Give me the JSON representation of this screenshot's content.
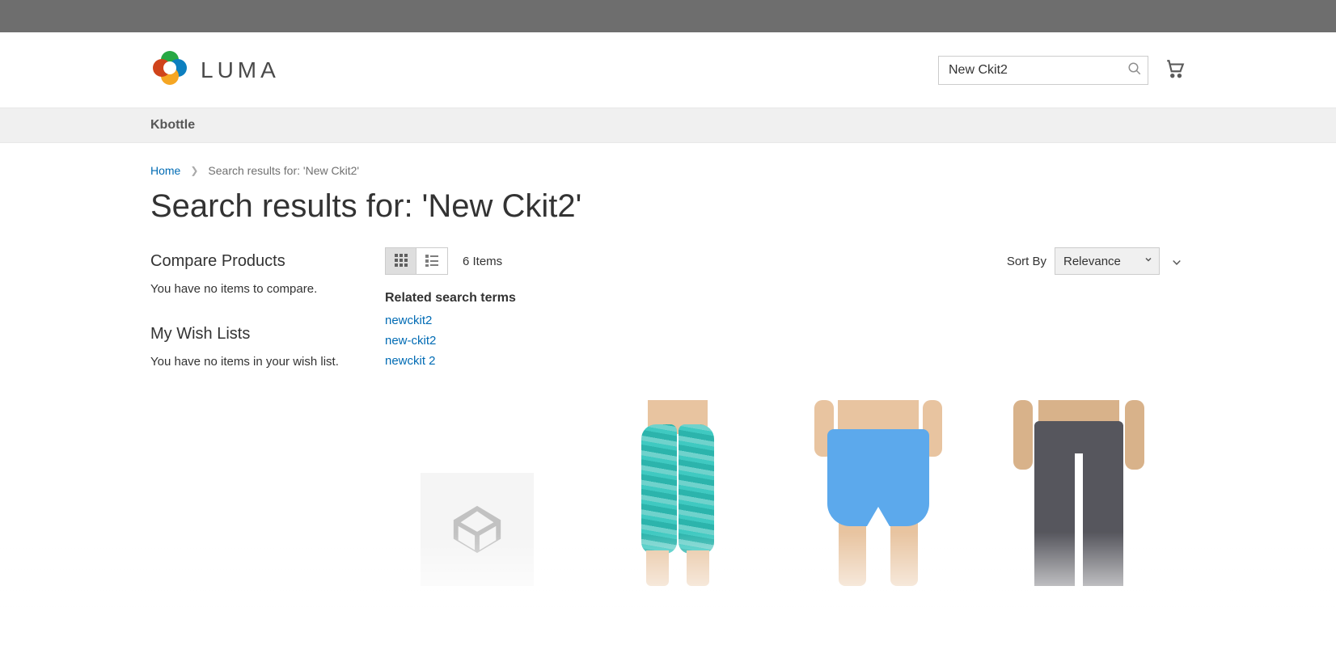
{
  "search": {
    "value": "New Ckit2"
  },
  "cart": {
    "label": "My Cart"
  },
  "nav": {
    "items": [
      "Kbottle"
    ]
  },
  "breadcrumb": {
    "home": "Home",
    "current": "Search results for: 'New Ckit2'"
  },
  "page_title": "Search results for: 'New Ckit2'",
  "sidebar": {
    "compare_heading": "Compare Products",
    "compare_empty": "You have no items to compare.",
    "wishlist_heading": "My Wish Lists",
    "wishlist_empty": "You have no items in your wish list."
  },
  "toolbar": {
    "item_count": "6 Items",
    "sort_label": "Sort By",
    "sort_options": [
      "Relevance"
    ],
    "sort_selected": "Relevance"
  },
  "related": {
    "heading": "Related search terms",
    "terms": [
      "newckit2",
      "new-ckit2",
      "newckit 2"
    ]
  }
}
